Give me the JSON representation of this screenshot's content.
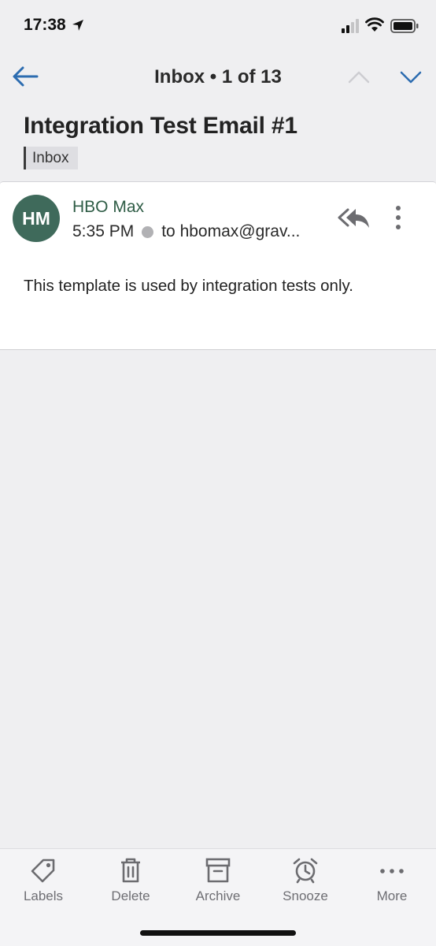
{
  "status_bar": {
    "time": "17:38"
  },
  "nav": {
    "title": "Inbox • 1 of 13"
  },
  "email": {
    "subject": "Integration Test Email #1",
    "label": "Inbox",
    "avatar_initials": "HM",
    "sender": "HBO Max",
    "time": "5:35 PM",
    "recipient": "to hbomax@grav...",
    "body": "This template is used by integration tests only."
  },
  "toolbar": {
    "labels": "Labels",
    "delete": "Delete",
    "archive": "Archive",
    "snooze": "Snooze",
    "more": "More"
  },
  "colors": {
    "accent": "#2c6cb0",
    "avatar": "#3f6a5b",
    "sender": "#2e5c45",
    "background": "#efeff1"
  }
}
